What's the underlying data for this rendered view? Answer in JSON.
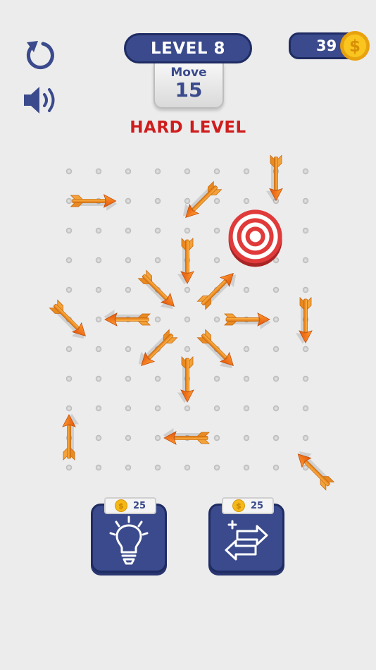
{
  "hud": {
    "level_label": "LEVEL 8",
    "move_label": "Move",
    "move_count": "15",
    "coins": "39",
    "difficulty_label": "HARD LEVEL"
  },
  "icons": {
    "restart": "restart-icon",
    "sound": "speaker-icon",
    "coin": "dollar-coin-icon",
    "hint": "lightbulb-icon",
    "swap": "swap-arrows-icon"
  },
  "tools": {
    "hint_price": "25",
    "swap_price": "25"
  },
  "board": {
    "grid_columns": 9,
    "grid_rows": 11,
    "target": {
      "col": 6.3,
      "row": 2.2
    },
    "arrows": [
      {
        "col": 0.8,
        "row": 1,
        "direction": "right"
      },
      {
        "col": 4.5,
        "row": 1,
        "direction": "down-left"
      },
      {
        "col": 7,
        "row": 0.2,
        "direction": "down"
      },
      {
        "col": 4,
        "row": 3,
        "direction": "down"
      },
      {
        "col": 3,
        "row": 4,
        "direction": "down-right"
      },
      {
        "col": 5,
        "row": 4,
        "direction": "up-right"
      },
      {
        "col": 0,
        "row": 5,
        "direction": "down-right"
      },
      {
        "col": 2,
        "row": 5,
        "direction": "left"
      },
      {
        "col": 6,
        "row": 5,
        "direction": "right"
      },
      {
        "col": 8,
        "row": 5,
        "direction": "down"
      },
      {
        "col": 3,
        "row": 6,
        "direction": "down-left"
      },
      {
        "col": 5,
        "row": 6,
        "direction": "down-right"
      },
      {
        "col": 4,
        "row": 7,
        "direction": "down"
      },
      {
        "col": 0,
        "row": 9,
        "direction": "up"
      },
      {
        "col": 4,
        "row": 9,
        "direction": "left"
      },
      {
        "col": 8.3,
        "row": 10.1,
        "direction": "up-left"
      }
    ]
  },
  "colors": {
    "panel_blue": "#3a4a8c",
    "panel_border": "#1f2c63",
    "arrow_orange": "#f08a1e",
    "difficulty_red": "#cf1c1c",
    "target_red": "#e03a3a",
    "coin_gold": "#f5b817"
  }
}
